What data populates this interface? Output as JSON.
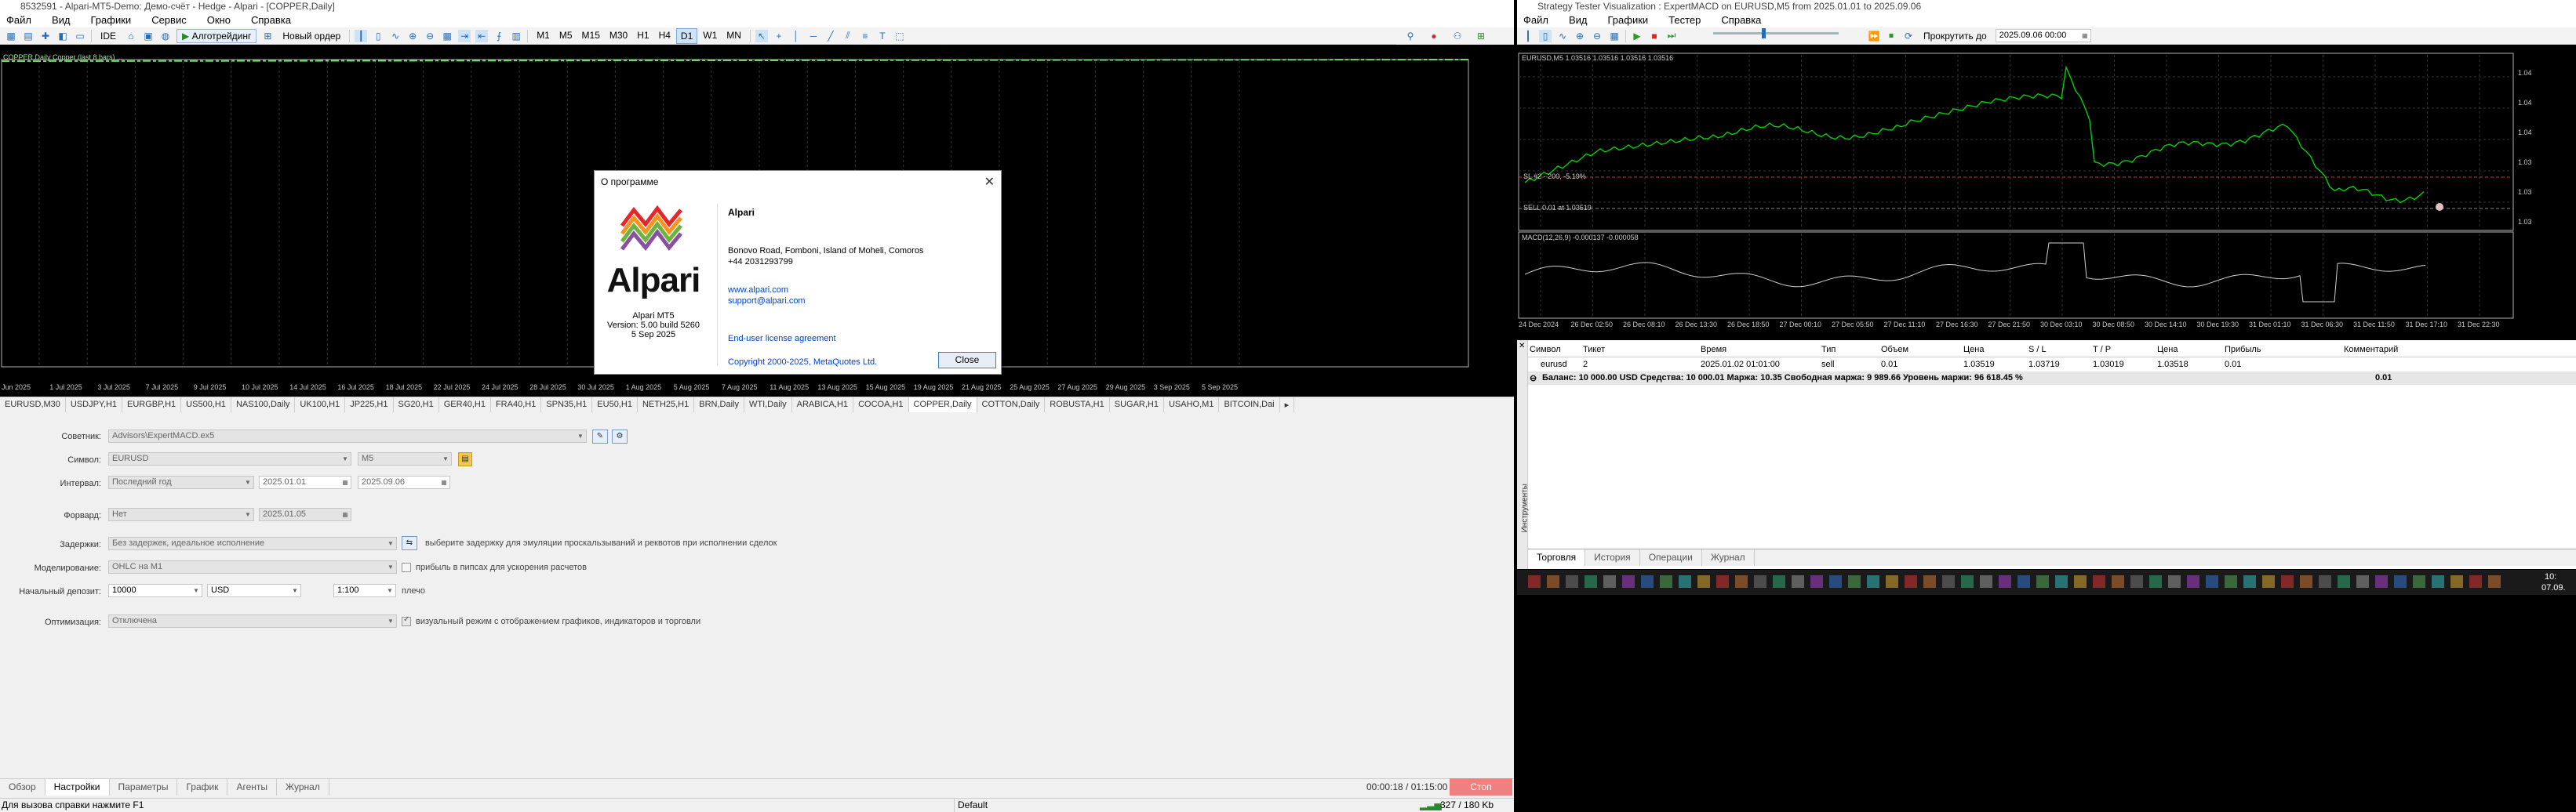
{
  "left_window": {
    "title": "8532591 - Alpari-MT5-Demo: Демо-счёт - Hedge - Alpari - [COPPER,Daily]",
    "menu": [
      "Файл",
      "Вид",
      "Графики",
      "Сервис",
      "Окно",
      "Справка"
    ],
    "toolbar": {
      "ide": "IDE",
      "algo": "Алготрейдинг",
      "new_order": "Новый ордер",
      "timeframes": [
        "M1",
        "M5",
        "M15",
        "M30",
        "H1",
        "H4",
        "D1",
        "W1",
        "MN"
      ],
      "selected_tf": "D1"
    },
    "chart_header": "COPPER,Daily  Copper  (last 8 bars)  ...",
    "x_axis_labels": [
      "Jun 2025",
      "1 Jul 2025",
      "3 Jul 2025",
      "7 Jul 2025",
      "9 Jul 2025",
      "10 Jul 2025",
      "14 Jul 2025",
      "16 Jul 2025",
      "18 Jul 2025",
      "22 Jul 2025",
      "24 Jul 2025",
      "28 Jul 2025",
      "30 Jul 2025",
      "1 Aug 2025",
      "5 Aug 2025",
      "7 Aug 2025",
      "11 Aug 2025",
      "13 Aug 2025",
      "15 Aug 2025",
      "19 Aug 2025",
      "21 Aug 2025",
      "25 Aug 2025",
      "27 Aug 2025",
      "29 Aug 2025",
      "3 Sep 2025",
      "5 Sep 2025"
    ],
    "symbol_tabs": [
      "EURUSD,M30",
      "USDJPY,H1",
      "EURGBP,H1",
      "US500,H1",
      "NAS100,Daily",
      "UK100,H1",
      "JP225,H1",
      "SG20,H1",
      "GER40,H1",
      "FRA40,H1",
      "SPN35,H1",
      "EU50,H1",
      "NETH25,H1",
      "BRN,Daily",
      "WTI,Daily",
      "ARABICA,H1",
      "COCOA,H1",
      "COPPER,Daily",
      "COTTON,Daily",
      "ROBUSTA,H1",
      "SUGAR,H1",
      "USAHO,M1",
      "BITCOIN,Dai"
    ]
  },
  "dialog": {
    "title": "О программе",
    "close_glyph": "✕",
    "logo_text": "Alpari",
    "product": "Alpari MT5",
    "version": "Version: 5.00 build 5260",
    "date": "5 Sep 2025",
    "company": "Alpari",
    "address": "Bonovo Road, Fomboni, Island of Moheli, Comoros",
    "phone": "+44 2031293799",
    "website": "www.alpari.com",
    "email": "support@alpari.com",
    "eula": "End-user license agreement",
    "copyright": "Copyright 2000-2025, MetaQuotes Ltd.",
    "close_button": "Close"
  },
  "tester": {
    "expert_label": "Советник:",
    "expert_value": "Advisors\\ExpertMACD.ex5",
    "symbol_label": "Символ:",
    "symbol_value": "EURUSD",
    "symbol_tf": "M5",
    "interval_label": "Интервал:",
    "interval_value": "Последний год",
    "date_from": "2025.01.01",
    "date_to": "2025.09.06",
    "forward_label": "Форвард:",
    "forward_value": "Нет",
    "forward_date": "2025.01.05",
    "delays_label": "Задержки:",
    "delays_value": "Без задержек, идеальное исполнение",
    "delays_note": "выберите задержку для эмуляции проскальзываний и реквотов при исполнении сделок",
    "model_label": "Моделирование:",
    "model_value": "OHLC на M1",
    "model_note": "прибыль в пипсах для ускорения расчетов",
    "deposit_label": "Начальный депозит:",
    "deposit_value": "10000",
    "currency": "USD",
    "leverage": "1:100",
    "leverage_note": "плечо",
    "optimization_label": "Оптимизация:",
    "optimization_value": "Отключена",
    "visual_note": "визуальный режим с отображением графиков, индикаторов и торговли",
    "tabs": [
      "Обзор",
      "Настройки",
      "Параметры",
      "График",
      "Агенты",
      "Журнал"
    ],
    "active_tab": "Настройки",
    "timer": "00:00:18 / 01:15:00",
    "stop_button": "Стоп"
  },
  "statusbar": {
    "help": "Для вызова справки нажмите F1",
    "profile": "Default",
    "traffic": "327 / 180 Kb"
  },
  "right_window": {
    "title": "Strategy Tester Visualization : ExpertMACD on EURUSD,M5 from 2025.01.01 to 2025.09.06",
    "menu": [
      "Файл",
      "Вид",
      "Графики",
      "Тестер",
      "Справка"
    ],
    "scroll_label": "Прокрутить до",
    "scroll_date": "2025.09.06 00:00",
    "chart_header": "EURUSD,M5  1.03516 1.03516 1.03516 1.03516",
    "sl_label": "SL #2 - 200, -5.19%",
    "sell_label": "SELL 0.01 at 1.03519",
    "macd_label": "MACD(12,26,9) -0.000137 -0.000058",
    "x_axis_labels": [
      "24 Dec 2024",
      "26 Dec 02:50",
      "26 Dec 08:10",
      "26 Dec 13:30",
      "26 Dec 18:50",
      "27 Dec 00:10",
      "27 Dec 05:50",
      "27 Dec 11:10",
      "27 Dec 16:30",
      "27 Dec 21:50",
      "30 Dec 03:10",
      "30 Dec 08:50",
      "30 Dec 14:10",
      "30 Dec 19:30",
      "31 Dec 01:10",
      "31 Dec 06:30",
      "31 Dec 11:50",
      "31 Dec 17:10",
      "31 Dec 22:30"
    ],
    "price_ticks": [
      "1.04",
      "1.04",
      "1.04",
      "1.03",
      "1.03",
      "1.03"
    ],
    "table_headers": [
      "Символ",
      "Тикет",
      "Время",
      "Тип",
      "Объем",
      "Цена",
      "S / L",
      "T / P",
      "Цена",
      "Прибыль",
      "Комментарий"
    ],
    "position": [
      "eurusd",
      "2",
      "2025.01.02 01:01:00",
      "sell",
      "0.01",
      "1.03519",
      "1.03719",
      "1.03019",
      "1.03518",
      "0.01",
      ""
    ],
    "balance_line": "Баланс: 10 000.00 USD  Средства: 10 000.01  Маржа: 10.35  Свободная маржа: 9 989.66  Уровень маржи: 96 618.45 %",
    "balance_profit": "0.01",
    "side_tab": "Инструменты",
    "tabs": [
      "Торговля",
      "История",
      "Операции",
      "Журнал"
    ],
    "active_tab": "Торговля",
    "clock_time": "10:",
    "clock_date": "07.09."
  },
  "colors": {
    "price_line": "#00d000",
    "macd": "#cfcfcf",
    "stop_red": "#f08080",
    "link": "#0044cc"
  }
}
